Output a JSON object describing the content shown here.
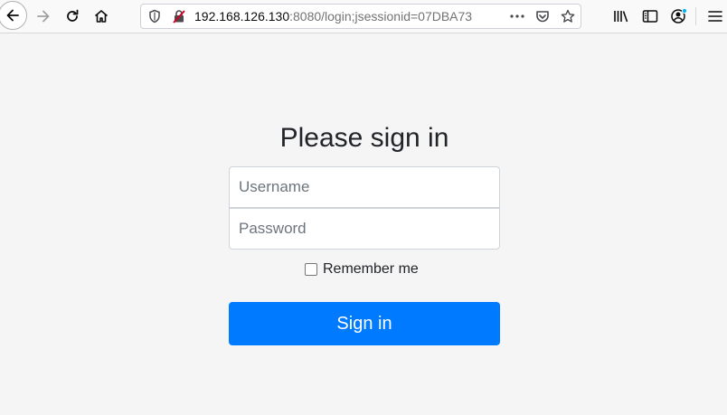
{
  "browser": {
    "url_host": "192.168.126.130",
    "url_rest": ":8080/login;jsessionid=07DBA73",
    "icons": [
      "back-arrow-icon",
      "forward-arrow-icon",
      "reload-icon",
      "home-icon",
      "shield-icon",
      "insecure-lock-icon",
      "more-dots-icon",
      "pocket-icon",
      "star-icon",
      "library-icon",
      "sidebar-icon",
      "account-icon",
      "menu-icon"
    ]
  },
  "login": {
    "heading": "Please sign in",
    "username_placeholder": "Username",
    "password_placeholder": "Password",
    "remember_label": "Remember me",
    "remember_checked": false,
    "submit_label": "Sign in"
  },
  "colors": {
    "button_bg": "#007bff",
    "page_bg": "#f5f5f5"
  }
}
